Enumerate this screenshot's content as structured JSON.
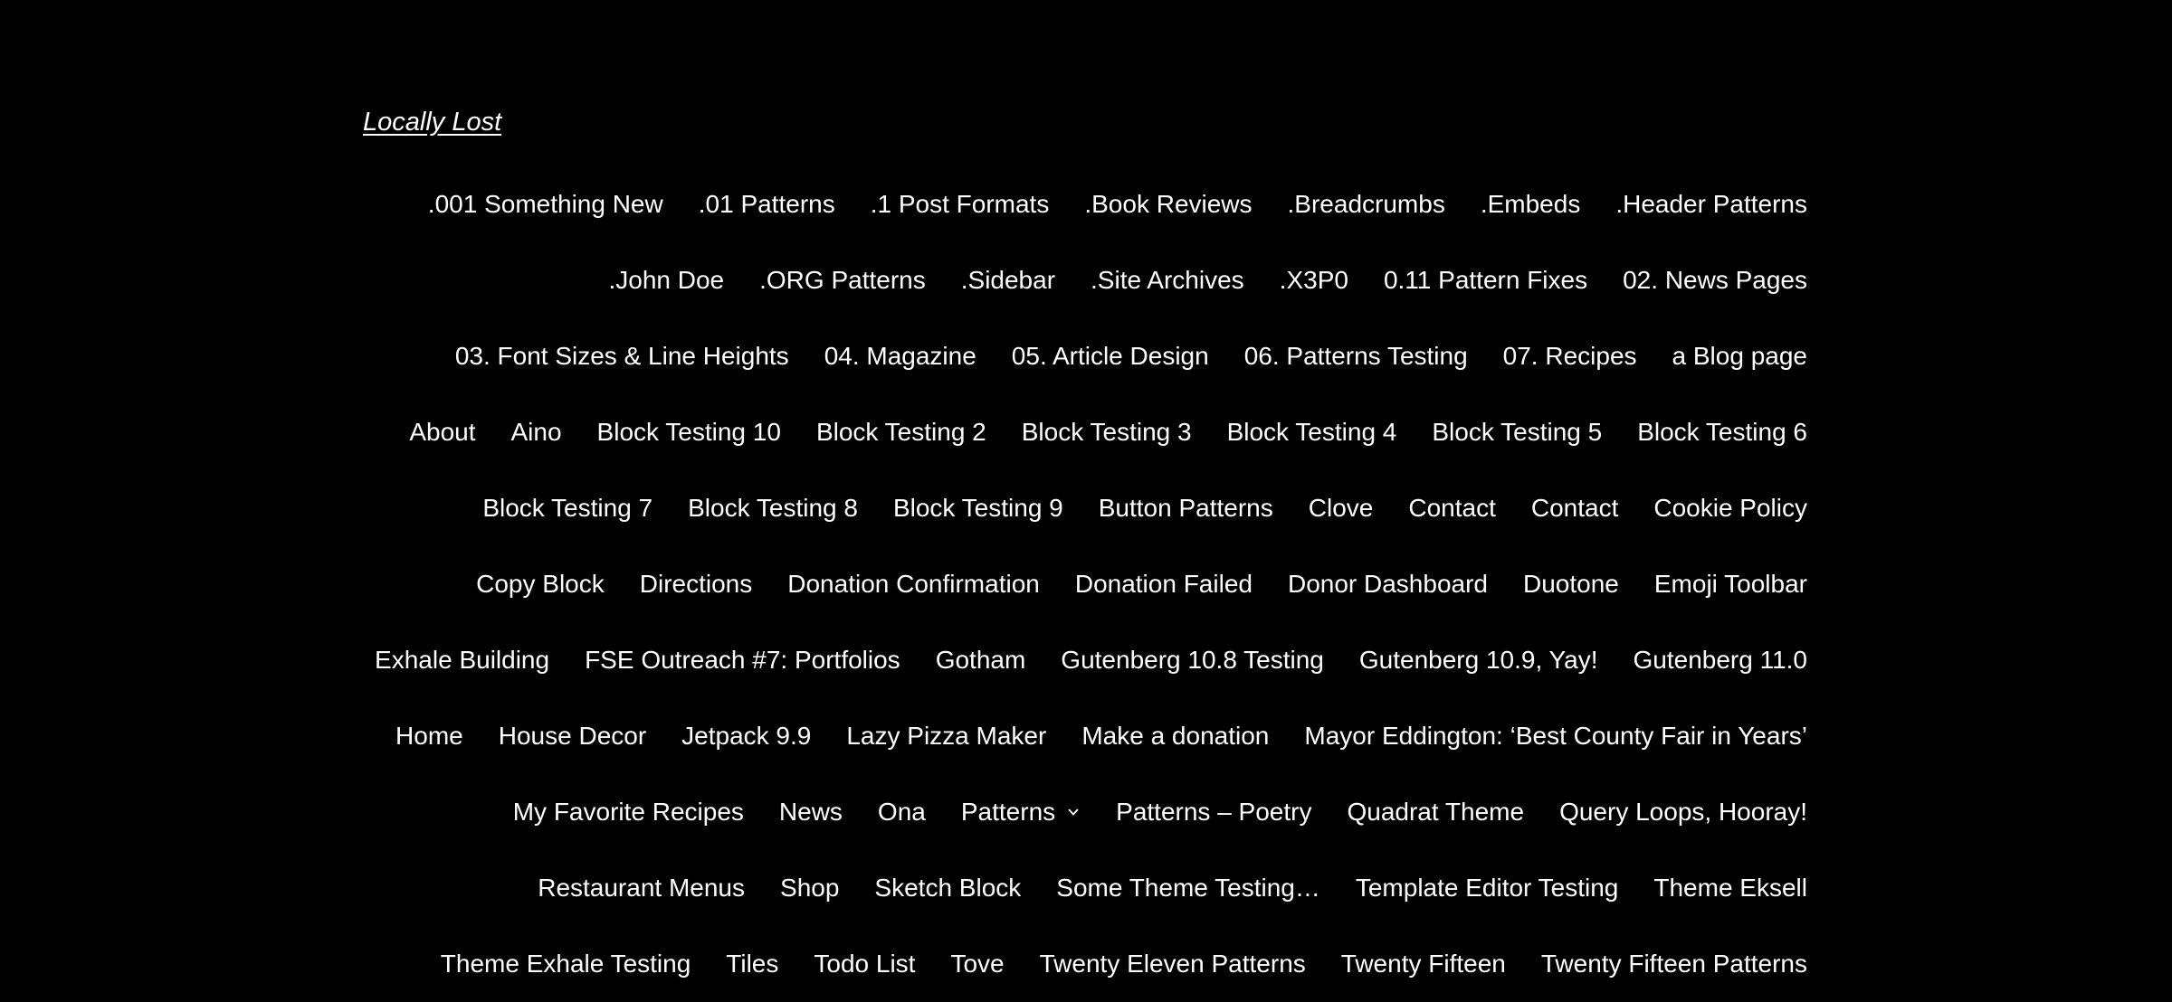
{
  "site": {
    "title": "Locally Lost"
  },
  "nav": {
    "rows": [
      [
        ".001 Something New",
        ".01 Patterns",
        ".1 Post Formats",
        ".Book Reviews",
        ".Breadcrumbs",
        ".Embeds",
        ".Header Patterns"
      ],
      [
        ".John Doe",
        ".ORG Patterns",
        ".Sidebar",
        ".Site Archives",
        ".X3P0",
        "0.11 Pattern Fixes",
        "02. News Pages"
      ],
      [
        "03. Font Sizes & Line Heights",
        "04. Magazine",
        "05. Article Design",
        "06. Patterns Testing",
        "07. Recipes",
        "a Blog page"
      ],
      [
        "About",
        "Aino",
        "Block Testing 10",
        "Block Testing 2",
        "Block Testing 3",
        "Block Testing 4",
        "Block Testing 5",
        "Block Testing 6"
      ],
      [
        "Block Testing 7",
        "Block Testing 8",
        "Block Testing 9",
        "Button Patterns",
        "Clove",
        "Contact",
        "Contact",
        "Cookie Policy"
      ],
      [
        "Copy Block",
        "Directions",
        "Donation Confirmation",
        "Donation Failed",
        "Donor Dashboard",
        "Duotone",
        "Emoji Toolbar"
      ],
      [
        "Exhale Building",
        "FSE Outreach #7: Portfolios",
        "Gotham",
        "Gutenberg 10.8 Testing",
        "Gutenberg 10.9, Yay!",
        "Gutenberg 11.0"
      ],
      [
        "Home",
        "House Decor",
        "Jetpack 9.9",
        "Lazy Pizza Maker",
        "Make a donation",
        "Mayor Eddington: ‘Best County Fair in Years’"
      ],
      [
        "My Favorite Recipes",
        "News",
        "Ona",
        "Patterns",
        "Patterns – Poetry",
        "Quadrat Theme",
        "Query Loops, Hooray!"
      ],
      [
        "Restaurant Menus",
        "Shop",
        "Sketch Block",
        "Some Theme Testing…",
        "Template Editor Testing",
        "Theme Eksell"
      ],
      [
        "Theme Exhale Testing",
        "Tiles",
        "Todo List",
        "Tove",
        "Twenty Eleven Patterns",
        "Twenty Fifteen",
        "Twenty Fifteen Patterns"
      ]
    ],
    "submenu_items": [
      "Patterns"
    ],
    "submenu_icon": "chevron-down-icon"
  }
}
